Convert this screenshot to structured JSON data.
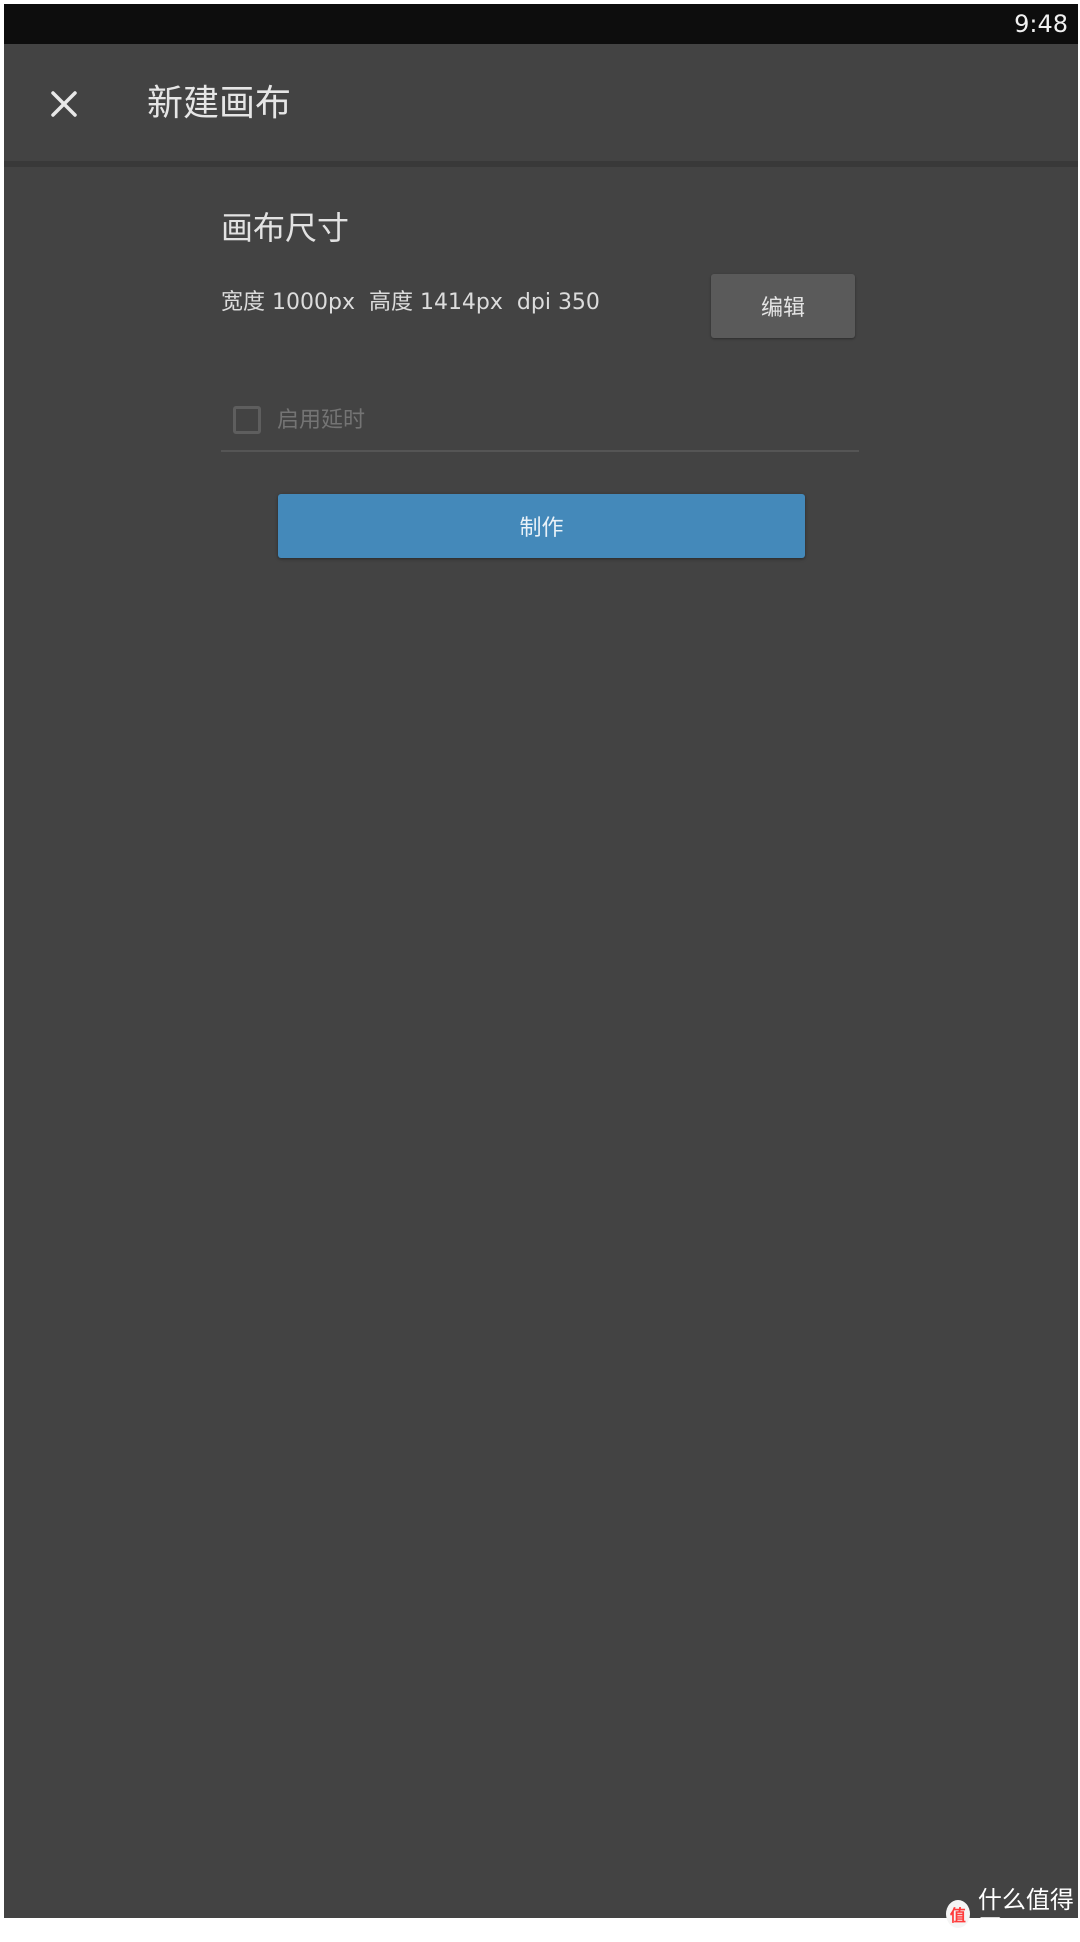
{
  "status_bar": {
    "time": "9:48"
  },
  "app_bar": {
    "close_icon": "close-icon",
    "title": "新建画布"
  },
  "canvas_size": {
    "section_title": "画布尺寸",
    "dimensions": "宽度 1000px  高度 1414px  dpi 350",
    "edit_label": "编辑"
  },
  "delay": {
    "checked": false,
    "label": "启用延时"
  },
  "actions": {
    "make_label": "制作"
  },
  "watermark": {
    "logo": "值",
    "text": "什么值得买"
  },
  "colors": {
    "background": "#434343",
    "status_bar": "#0d0d0d",
    "primary_button": "#4489ba",
    "secondary_button": "#5a5a5a"
  }
}
